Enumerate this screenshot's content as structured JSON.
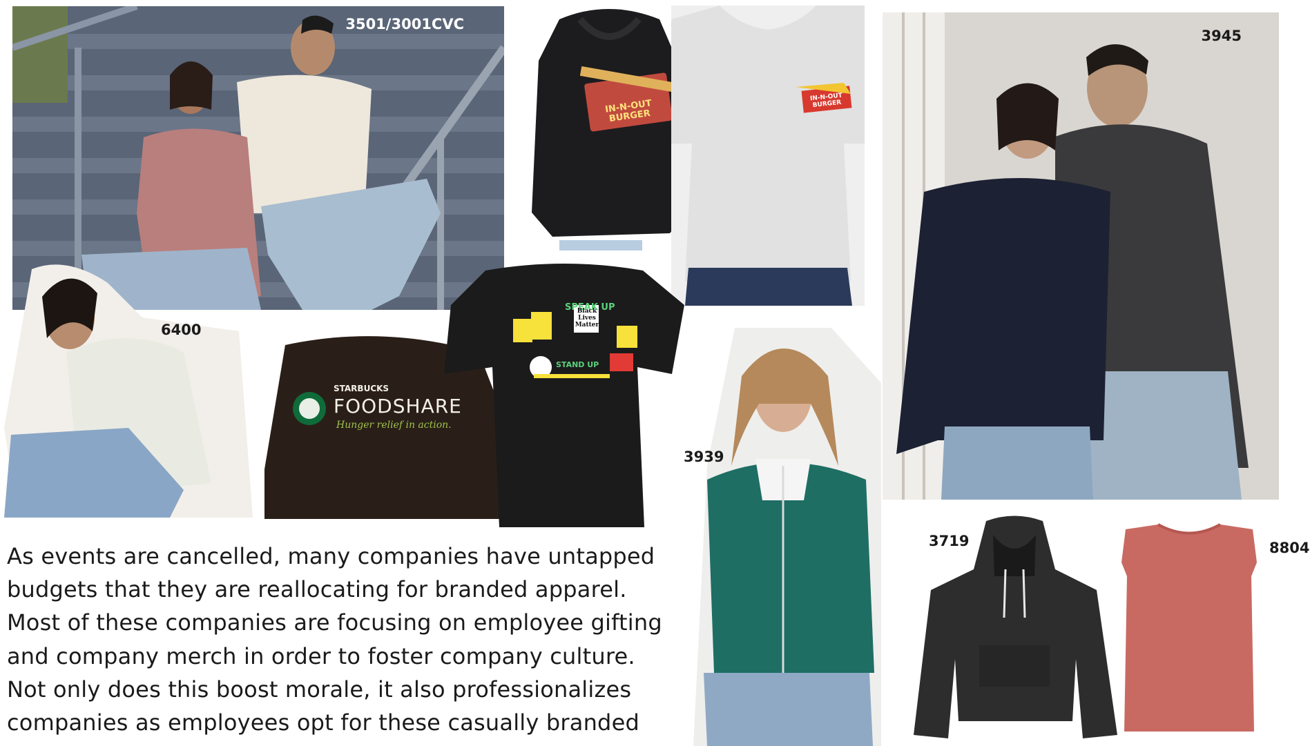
{
  "labels": {
    "stairs": "3501/3001CVC",
    "tee_seated": "6400",
    "couple_crew": "3945",
    "zip_hoodie": "3939",
    "hoodie": "3719",
    "muscle_tank": "8804"
  },
  "graphics": {
    "in_n_out": "IN-N-OUT BURGER",
    "starbucks": "STARBUCKS",
    "foodshare": "FOODSHARE",
    "hunger_relief": "Hunger relief in action.",
    "black_lives_matter": "Black Lives Matter",
    "speak_up": "SPEAK UP",
    "stand_up": "STAND UP"
  },
  "paragraph": {
    "lines": [
      "As events are cancelled, many companies have untapped",
      "budgets that they are reallocating for branded apparel.",
      "Most of these companies are focusing on employee gifting",
      "and company merch in order to foster company culture.",
      "Not only does this boost morale, it also professionalizes",
      "companies as employees opt for these casually branded"
    ]
  },
  "colors": {
    "stairs_bg": "#4a5566",
    "pink_raglan": "#b87a7a",
    "cream_tee": "#ece6da",
    "black_jacket": "#1c1c1e",
    "gray_tee": "#e2e2e2",
    "navy_crew": "#1c2133",
    "charcoal_crew": "#3a3a3c",
    "teal_hoodie": "#1e6e64",
    "hoodie_black": "#2d2d2d",
    "tank_red": "#c96a62",
    "text": "#1a1a1a"
  }
}
